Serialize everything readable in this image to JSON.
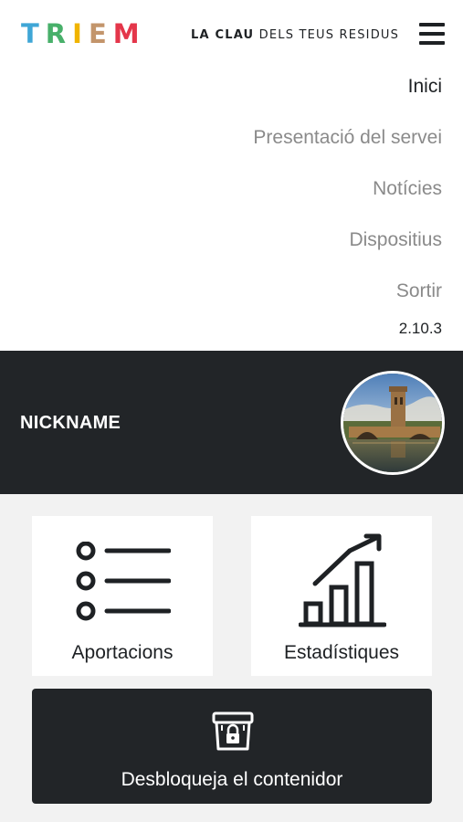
{
  "header": {
    "logo_letters": [
      "T",
      "R",
      "I",
      "E",
      "M"
    ],
    "logo_colors": [
      "#3fa6d6",
      "#48b06a",
      "#f0b400",
      "#c3956b",
      "#e4364a"
    ],
    "tagline_bold": "LA CLAU",
    "tagline_rest": "DELS TEUS RESIDUS",
    "menu_icon": "hamburger-icon"
  },
  "menu": {
    "items": [
      {
        "label": "Inici",
        "active": true
      },
      {
        "label": "Presentació del servei",
        "active": false
      },
      {
        "label": "Notícies",
        "active": false
      },
      {
        "label": "Dispositius",
        "active": false
      },
      {
        "label": "Sortir",
        "active": false
      }
    ],
    "version": "2.10.3"
  },
  "profile": {
    "nickname": "NICKNAME",
    "avatar_icon": "bridge-photo-avatar"
  },
  "actions": {
    "contributions": {
      "label": "Aportacions",
      "icon": "list-icon"
    },
    "statistics": {
      "label": "Estadístiques",
      "icon": "bar-chart-growth-icon"
    },
    "unlock": {
      "label": "Desbloqueja el contenidor",
      "icon": "locked-container-icon"
    }
  },
  "colors": {
    "dark": "#222528",
    "background": "#f2f2f2",
    "muted_text": "#8a8a8a"
  }
}
